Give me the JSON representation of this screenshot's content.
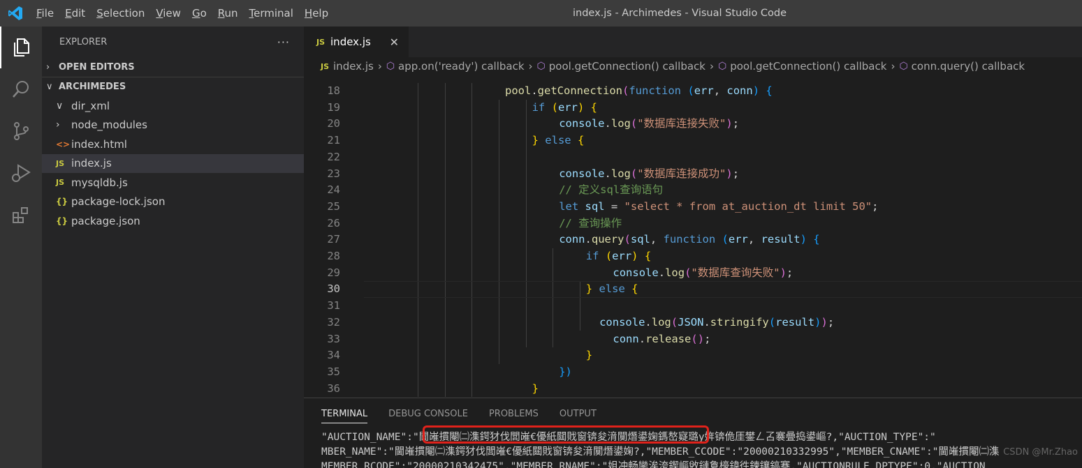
{
  "window": {
    "title": "index.js - Archimedes - Visual Studio Code",
    "app_icon": "vscode-logo-icon",
    "menu": [
      {
        "label": "File",
        "ul": "F",
        "rest": "ile"
      },
      {
        "label": "Edit",
        "ul": "E",
        "rest": "dit"
      },
      {
        "label": "Selection",
        "ul": "S",
        "rest": "election"
      },
      {
        "label": "View",
        "ul": "V",
        "rest": "iew"
      },
      {
        "label": "Go",
        "ul": "G",
        "rest": "o"
      },
      {
        "label": "Run",
        "ul": "R",
        "rest": "un"
      },
      {
        "label": "Terminal",
        "ul": "T",
        "rest": "erminal"
      },
      {
        "label": "Help",
        "ul": "H",
        "rest": "elp"
      }
    ]
  },
  "activity_bar": [
    "files-icon",
    "search-icon",
    "source-control-icon",
    "run-debug-icon",
    "extensions-icon"
  ],
  "sidebar": {
    "title": "EXPLORER",
    "more": "···",
    "open_editors": "OPEN EDITORS",
    "project": "ARCHIMEDES",
    "items": [
      {
        "label": "dir_xml",
        "icon": "chevron-down-icon",
        "glyph": "∨"
      },
      {
        "label": "node_modules",
        "icon": "chevron-right-icon",
        "glyph": "›"
      },
      {
        "label": "index.html",
        "icon": "html-file-icon",
        "glyph": "<>"
      },
      {
        "label": "index.js",
        "icon": "js-file-icon",
        "glyph": "JS",
        "selected": true
      },
      {
        "label": "mysqldb.js",
        "icon": "js-file-icon",
        "glyph": "JS"
      },
      {
        "label": "package-lock.json",
        "icon": "json-file-icon",
        "glyph": "{}"
      },
      {
        "label": "package.json",
        "icon": "json-file-icon",
        "glyph": "{}"
      }
    ]
  },
  "editor": {
    "tab": {
      "label": "index.js",
      "badge": "JS",
      "close": "✕"
    },
    "breadcrumb": {
      "file": "index.js",
      "file_badge": "JS",
      "items": [
        "app.on('ready') callback",
        "pool.getConnection() callback",
        "pool.getConnection() callback",
        "conn.query() callback"
      ]
    },
    "current_line": "30",
    "lines": [
      {
        "n": "18",
        "html": "<span class='f'>pool</span>.<span class='f'>getConnection</span><span class='b2'>(</span><span class='k'>function</span> <span class='b3'>(</span><span class='v'>err</span>, <span class='v'>conn</span><span class='b3'>)</span> <span class='b3'>{</span>",
        "indent": 5
      },
      {
        "n": "19",
        "html": "<span class='k'>if</span> <span class='b1'>(</span><span class='v'>err</span><span class='b1'>)</span> <span class='b1'>{</span>",
        "indent": 6
      },
      {
        "n": "20",
        "html": "<span class='v'>console</span>.<span class='f'>log</span><span class='b2'>(</span><span class='s'>\"数据库连接失败\"</span><span class='b2'>)</span>;",
        "indent": 7
      },
      {
        "n": "21",
        "html": "<span class='b1'>}</span> <span class='k'>else</span> <span class='b1'>{</span>",
        "indent": 6
      },
      {
        "n": "22",
        "html": "",
        "indent": 7
      },
      {
        "n": "23",
        "html": "<span class='v'>console</span>.<span class='f'>log</span><span class='b2'>(</span><span class='s'>\"数据库连接成功\"</span><span class='b2'>)</span>;",
        "indent": 7
      },
      {
        "n": "24",
        "html": "<span class='c'>// 定义sql查询语句</span>",
        "indent": 7
      },
      {
        "n": "25",
        "html": "<span class='k'>let</span> <span class='v'>sql</span> = <span class='s'>\"select * from at_auction_dt limit 50\"</span>;",
        "indent": 7
      },
      {
        "n": "26",
        "html": "<span class='c'>// 查询操作</span>",
        "indent": 7
      },
      {
        "n": "27",
        "html": "<span class='v'>conn</span>.<span class='f'>query</span><span class='b2'>(</span><span class='v'>sql</span>, <span class='k'>function</span> <span class='b3'>(</span><span class='v'>err</span>, <span class='v'>result</span><span class='b3'>)</span> <span class='b3'>{</span>",
        "indent": 7
      },
      {
        "n": "28",
        "html": "<span class='k'>if</span> <span class='b1'>(</span><span class='v'>err</span><span class='b1'>)</span> <span class='b1'>{</span>",
        "indent": 8
      },
      {
        "n": "29",
        "html": "<span class='v'>console</span>.<span class='f'>log</span><span class='b2'>(</span><span class='s'>\"数据库查询失败\"</span><span class='b2'>)</span>;",
        "indent": 9
      },
      {
        "n": "30",
        "html": "<span class='b1'>}</span> <span class='k'>else</span> <span class='b1'>{</span>",
        "indent": 8
      },
      {
        "n": "31",
        "html": "",
        "indent": 9
      },
      {
        "n": "32",
        "html": "<span class='v'>console</span>.<span class='f'>log</span><span class='b2'>(</span><span class='v'>JSON</span>.<span class='f'>stringify</span><span class='b3'>(</span><span class='v'>result</span><span class='b3'>)</span><span class='b2'>)</span>;",
        "indent": 8.5
      },
      {
        "n": "33",
        "html": "<span class='v'>conn</span>.<span class='f'>release</span><span class='b2'>()</span>;",
        "indent": 9
      },
      {
        "n": "34",
        "html": "<span class='b1'>}</span>",
        "indent": 8
      },
      {
        "n": "35",
        "html": "<span class='b3'>})</span>",
        "indent": 7
      },
      {
        "n": "36",
        "html": "<span class='b1'>}</span>",
        "indent": 6
      }
    ]
  },
  "panel": {
    "tabs": [
      "TERMINAL",
      "DEBUG CONSOLE",
      "PROBLEMS",
      "OUTPUT"
    ],
    "active_tab": "TERMINAL",
    "terminal_lines": [
      "\"AUCTION_NAME\":\"閫嶉摜閹㈡潗鍔犲伐閭嶉€優紙閮戝窗锛夋湇闃熸鍙婅鎷嶅寲璐у姩锛佹厓鐢ㄥ叾褰曡捣鍙嶇?,\"AUCTION_TYPE\":\"",
      "MBER_NAME\":\"閫嶉摜閹㈡潗鍔犲伐閭嶉€優紙閮戝窗锛夋湇闃熸鍙婅?,\"MEMBER_CCODE\":\"20000210332995\",\"MEMBER_CNAME\":\"閫嶉摜閹㈡潗",
      "MEMBER_RCODE\":\"20000210342475\",\"MEMBER_RNAME\":\"姐冲畅鑾涘洿鍥嶇敓鏈夐檺鍏徃鍊鑲鎬蹇,\"AUCTIONRULE_DPTYPE\":0,\"AUCTION"
    ],
    "watermark": "CSDN @Mr.Zhao"
  },
  "colors": {
    "accent": "#007acc",
    "highlight_box": "#e0221b"
  }
}
